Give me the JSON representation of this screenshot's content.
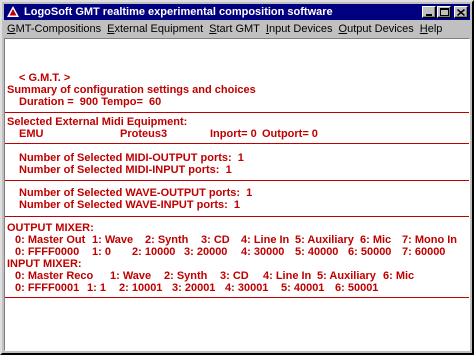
{
  "window": {
    "title": "LogoSoft GMT realtime experimental composition software"
  },
  "menu": [
    {
      "pre": "",
      "ul": "G",
      "post": "MT-Compositions"
    },
    {
      "pre": "",
      "ul": "E",
      "post": "xternal Equipment"
    },
    {
      "pre": "",
      "ul": "S",
      "post": "tart GMT"
    },
    {
      "pre": "",
      "ul": "I",
      "post": "nput Devices"
    },
    {
      "pre": "",
      "ul": "O",
      "post": "utput Devices"
    },
    {
      "pre": "",
      "ul": "H",
      "post": "elp"
    }
  ],
  "summary": {
    "header": "< G.M.T. >",
    "title": "Summary of configuration settings and choices",
    "duration_line": "Duration =  900 Tempo=  60"
  },
  "midi": {
    "title": "Selected External Midi Equipment:",
    "device1": "EMU",
    "device2": "Proteus3",
    "inport": "Inport= 0",
    "outport": "Outport= 0"
  },
  "ports": {
    "midi_out": "Number of Selected MIDI-OUTPUT ports:  1",
    "midi_in": "Number of Selected MIDI-INPUT ports:  1",
    "wave_out": "Number of Selected WAVE-OUTPUT ports:  1",
    "wave_in": "Number of Selected WAVE-INPUT ports:  1"
  },
  "output_mixer": {
    "title": "OUTPUT MIXER:",
    "names": [
      "0: Master Out",
      "1: Wave",
      "2: Synth",
      "3: CD",
      "4: Line In",
      "5: Auxiliary",
      "6: Mic",
      "7: Mono In"
    ],
    "values": [
      "0: FFFF0000",
      "1: 0",
      "2: 10000",
      "3: 20000",
      "4: 30000",
      "5: 40000",
      "6: 50000",
      "7: 60000"
    ]
  },
  "input_mixer": {
    "title": "INPUT MIXER:",
    "names": [
      "0: Master Reco",
      "1: Wave",
      "2: Synth",
      "3: CD",
      "4: Line In",
      "5: Auxiliary",
      "6: Mic"
    ],
    "values": [
      "0: FFFF0001",
      "1: 1",
      "2: 10001",
      "3: 20001",
      "4: 30001",
      "5: 40001",
      "6: 50001"
    ]
  },
  "colors": {
    "title_bar": "#000080",
    "text": "#c00000"
  }
}
